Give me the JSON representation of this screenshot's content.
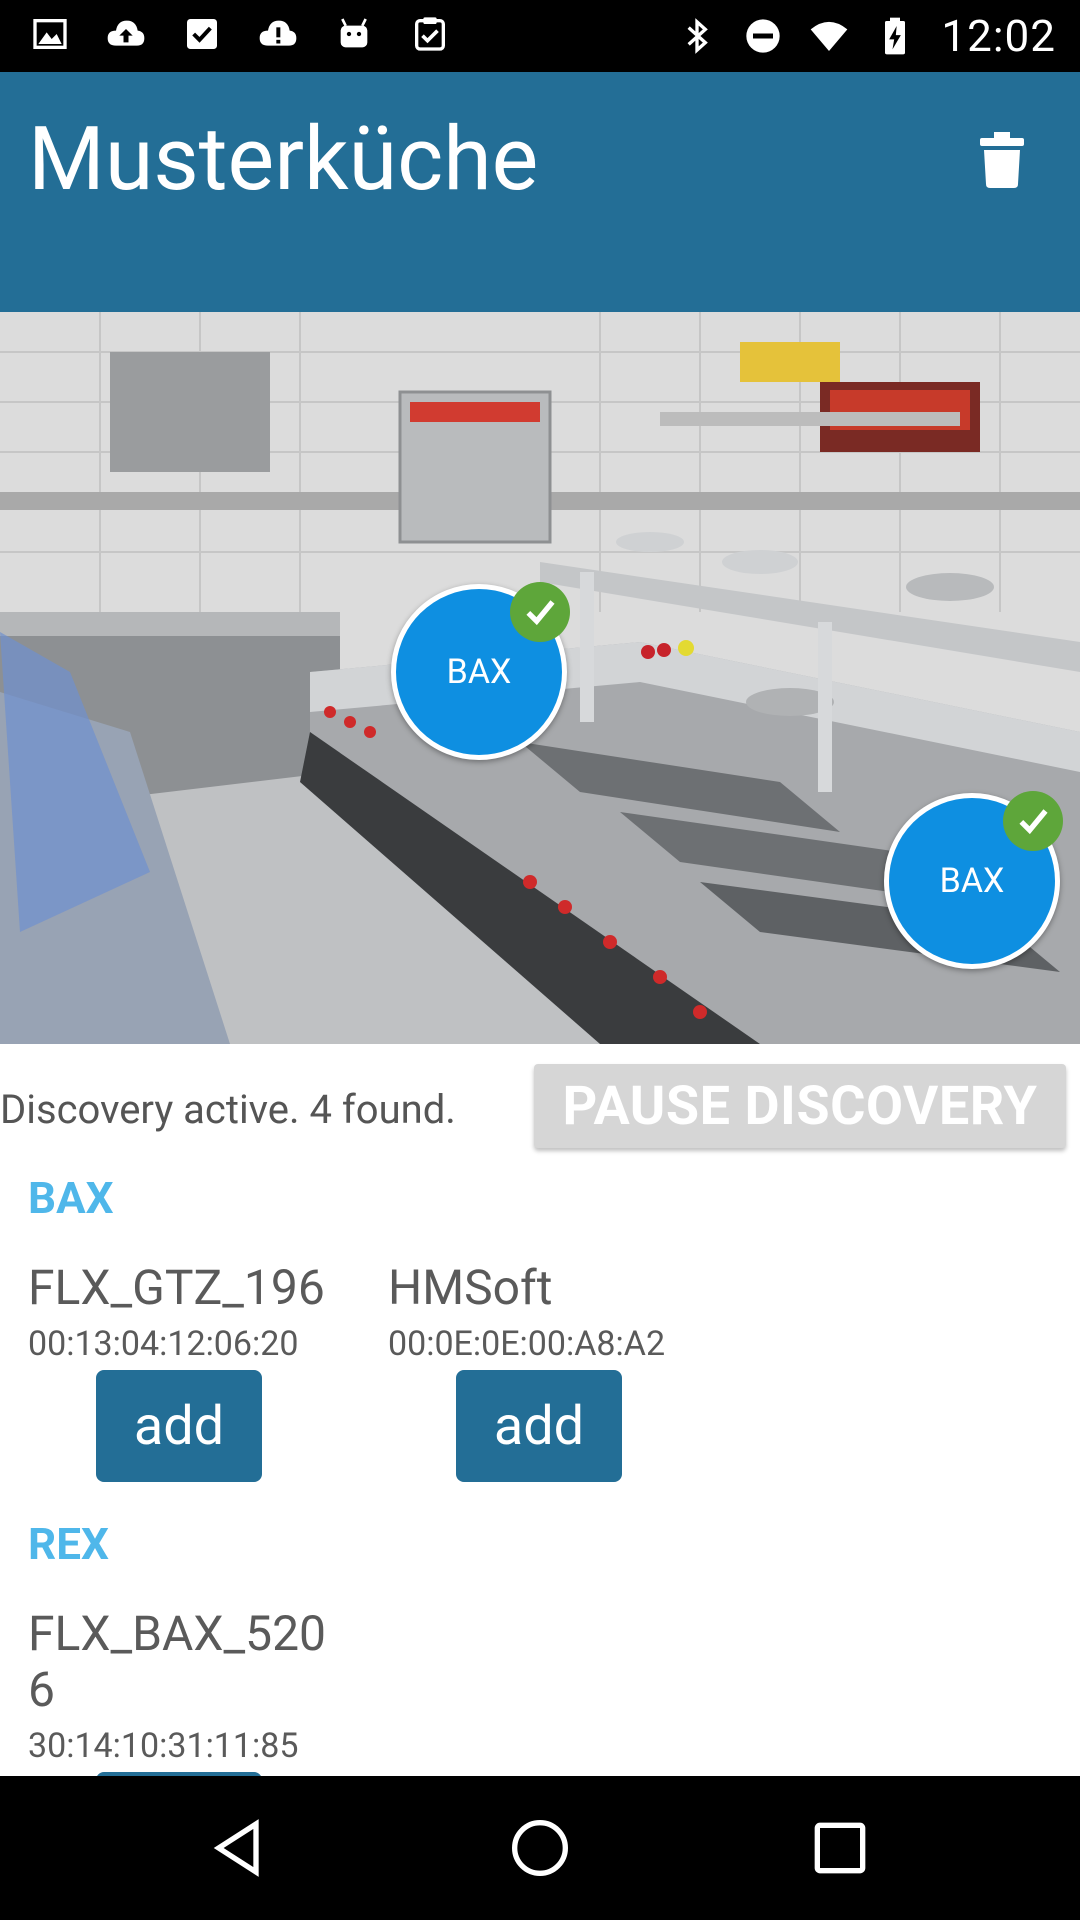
{
  "status_bar": {
    "time": "12:02",
    "left_icons": [
      "image-icon",
      "cloud-upload-icon",
      "checkbox-icon",
      "cloud-alert-icon",
      "android-icon",
      "clipboard-check-icon"
    ],
    "right_icons": [
      "bluetooth-icon",
      "do-not-disturb-icon",
      "wifi-icon",
      "battery-charging-icon"
    ]
  },
  "app_bar": {
    "title": "Musterküche",
    "action_icon": "trash-icon",
    "background_color": "#236e96"
  },
  "kitchen_image": {
    "markers": [
      {
        "label": "BAX",
        "status": "check-icon"
      },
      {
        "label": "BAX",
        "status": "check-icon"
      }
    ],
    "marker_color": "#0e8fe1",
    "check_color": "#5ea63a"
  },
  "discovery": {
    "status_text": "Discovery active. 4 found.",
    "pause_button_label": "PAUSE DISCOVERY"
  },
  "sections": [
    {
      "heading": "BAX",
      "devices": [
        {
          "name": "FLX_GTZ_196",
          "mac": "00:13:04:12:06:20",
          "action_label": "add"
        },
        {
          "name": "HMSoft",
          "mac": "00:0E:0E:00:A8:A2",
          "action_label": "add"
        }
      ]
    },
    {
      "heading": "REX",
      "devices": [
        {
          "name": "FLX_BAX_5206",
          "mac": "30:14:10:31:11:85",
          "action_label": "add"
        }
      ]
    }
  ],
  "nav_bar": {
    "buttons": [
      "back-icon",
      "home-icon",
      "recents-icon"
    ]
  },
  "colors": {
    "accent_heading": "#4fb7ea",
    "primary": "#236e96",
    "disabled_button": "#d6d6d6"
  }
}
